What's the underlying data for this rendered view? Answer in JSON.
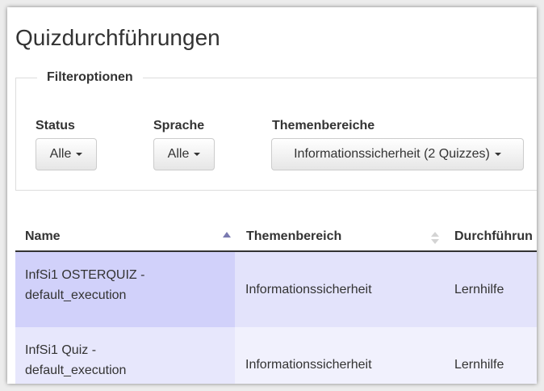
{
  "page": {
    "title": "Quizdurchführungen"
  },
  "filters": {
    "legend": "Filteroptionen",
    "status": {
      "label": "Status",
      "selected": "Alle"
    },
    "language": {
      "label": "Sprache",
      "selected": "Alle"
    },
    "topics": {
      "label": "Themenbereiche",
      "selected": "Informationssicherheit (2 Quizzes)"
    }
  },
  "table": {
    "columns": [
      "Name",
      "Themenbereich",
      "Durchführun"
    ],
    "sort": {
      "column": "Name",
      "direction": "ascending"
    },
    "rows": [
      {
        "name_line1": "InfSi1 OSTERQUIZ -",
        "name_line2": "default_execution",
        "topic": "Informationssicherheit",
        "type": "Lernhilfe"
      },
      {
        "name_line1": "InfSi1 Quiz -",
        "name_line2": "default_execution",
        "topic": "Informationssicherheit",
        "type": "Lernhilfe"
      }
    ]
  },
  "icons": [
    "caret-down-icon",
    "sort-ascending-icon",
    "sort-both-icon"
  ],
  "colors": {
    "row_selected": "#d1d1fa",
    "row_highlight": "#e3e3fb",
    "row_alt": "#f1f1fd",
    "sort_active": "#7a7ab0"
  }
}
